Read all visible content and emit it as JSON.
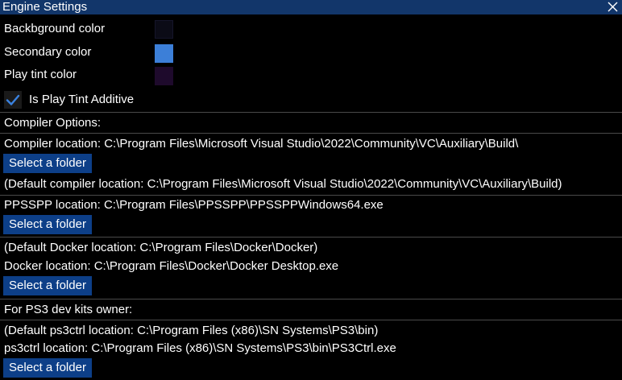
{
  "window": {
    "title": "Engine Settings"
  },
  "colors": {
    "background_label": "Backbground color",
    "background_value": "#0b0b16",
    "secondary_label": "Secondary color",
    "secondary_value": "#3c7fd8",
    "play_tint_label": "Play tint color",
    "play_tint_value": "#1e0a2c"
  },
  "play_tint_additive": {
    "label": "Is Play Tint Additive",
    "checked": true
  },
  "compiler": {
    "section_title": "Compiler Options:",
    "location": "Compiler location: C:\\Program Files\\Microsoft Visual Studio\\2022\\Community\\VC\\Auxiliary\\Build\\",
    "button": "Select a folder",
    "default_location": "(Default compiler location: C:\\Program Files\\Microsoft Visual Studio\\2022\\Community\\VC\\Auxiliary\\Build)"
  },
  "ppsspp": {
    "location": "PPSSPP location: C:\\Program Files\\PPSSPP\\PPSSPPWindows64.exe",
    "button": "Select a folder"
  },
  "docker": {
    "default_location": "(Default Docker location: C:\\Program Files\\Docker\\Docker)",
    "location": "Docker location: C:\\Program Files\\Docker\\Docker Desktop.exe",
    "button": "Select a folder"
  },
  "ps3": {
    "section_title": "For PS3 dev kits owner:",
    "default_location": "(Default ps3ctrl location: C:\\Program Files (x86)\\SN Systems\\PS3\\bin)",
    "location": "ps3ctrl location: C:\\Program Files (x86)\\SN Systems\\PS3\\bin\\PS3Ctrl.exe",
    "button": "Select a folder"
  },
  "icons": {
    "close": "close-icon",
    "check": "checkmark-icon"
  }
}
